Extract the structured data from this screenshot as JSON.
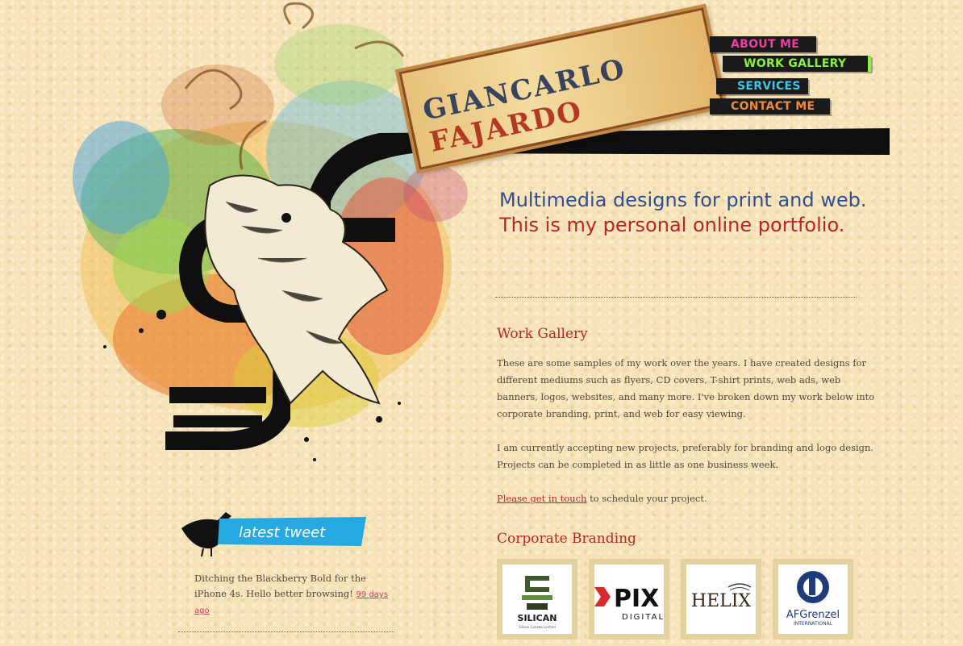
{
  "header": {
    "logo_first": "GIANCARLO",
    "logo_last": "FAJARDO"
  },
  "nav": {
    "about": "ABOUT ME",
    "gallery": "WORK GALLERY",
    "services": "SERVICES",
    "contact": "CONTACT ME"
  },
  "tagline": {
    "line1": "Multimedia designs for print and web.",
    "line2": "This is my personal online portfolio."
  },
  "work_gallery": {
    "heading": "Work Gallery",
    "paragraph1": "These are some samples of my work over the years. I have created designs for different mediums such as flyers, CD covers, T-shirt prints, web ads, web banners, logos, websites, and many more. I've broken down my work below into corporate branding, print, and web for easy viewing.",
    "paragraph2": "I am currently accepting new projects, preferably for branding and logo design. Projects can be completed in as little as one business week.",
    "contact_link": "Please get in touch",
    "contact_suffix": " to schedule your project."
  },
  "corporate_branding": {
    "heading": "Corporate Branding",
    "items": [
      {
        "name": "SILICAN",
        "sub": "Silicon Canada Limited"
      },
      {
        "name": "PIX",
        "sub": "DIGITAL"
      },
      {
        "name": "HELIX"
      },
      {
        "name": "AFGrenzel",
        "sub": "INTERNATIONAL"
      }
    ]
  },
  "tweet": {
    "badge": "latest tweet",
    "text": "Ditching the Blackberry Bold for the iPhone 4s. Hello better browsing!",
    "time": "99 days ago"
  }
}
